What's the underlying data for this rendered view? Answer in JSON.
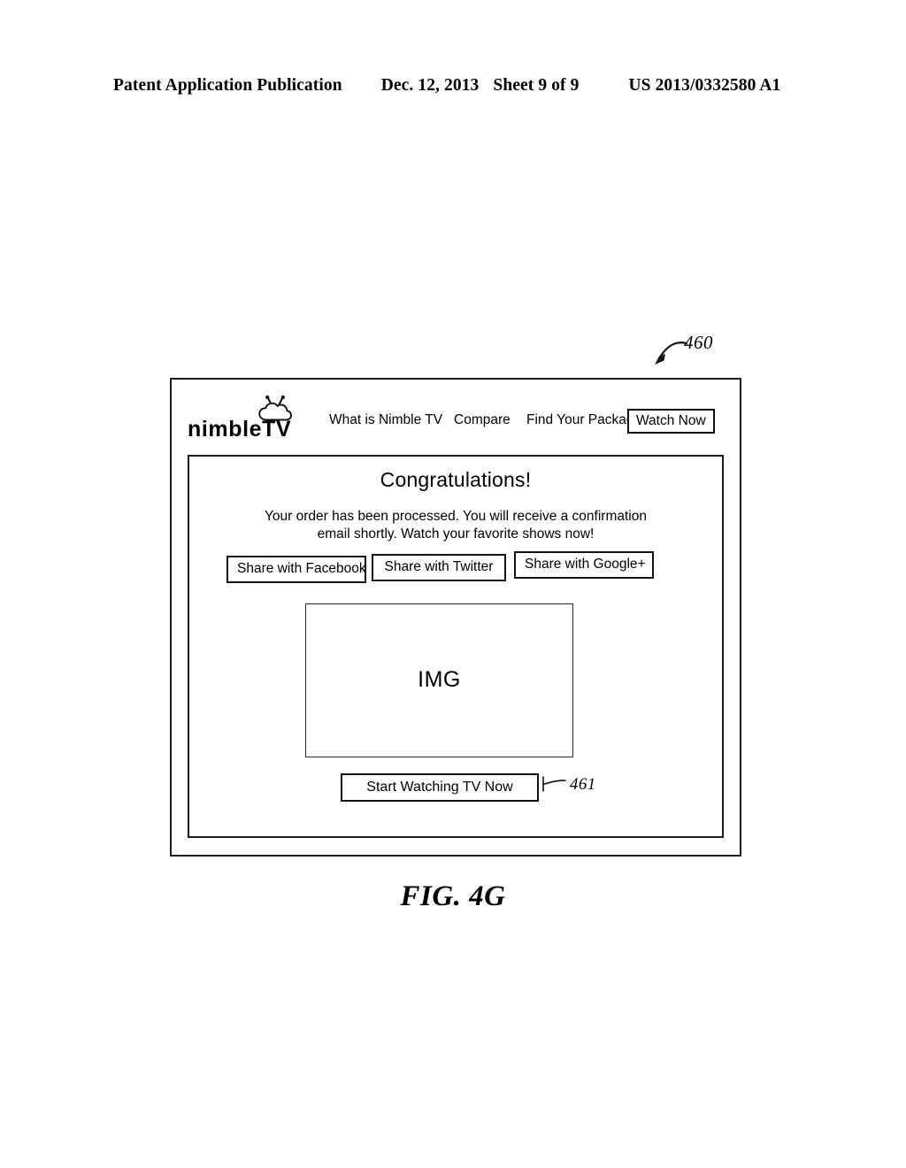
{
  "page_header": {
    "publication": "Patent Application Publication",
    "date": "Dec. 12, 2013",
    "sheet": "Sheet 9 of 9",
    "patent_number": "US 2013/0332580 A1"
  },
  "figure": {
    "caption": "FIG. 4G",
    "reference_numerals": {
      "window": "460",
      "start_button": "461"
    }
  },
  "browser": {
    "nav": {
      "logo_text": "nimbleTV",
      "logo_icon": "cloud-antenna-icon",
      "links": [
        {
          "label": "What is Nimble TV"
        },
        {
          "label": "Compare"
        },
        {
          "label": "Find Your Package"
        }
      ],
      "cta_label": "Watch Now"
    },
    "content": {
      "heading": "Congratulations!",
      "message": "Your order has been processed. You will receive a confirmation email shortly. Watch your favorite shows now!",
      "share_buttons": [
        {
          "label": "Share with Facebook"
        },
        {
          "label": "Share with Twitter"
        },
        {
          "label": "Share with Google+"
        }
      ],
      "image_placeholder": "IMG",
      "start_button_label": "Start Watching TV Now"
    }
  },
  "colors": {
    "ink": "#000000",
    "frame": "#1c1c1c",
    "paper": "#ffffff"
  }
}
